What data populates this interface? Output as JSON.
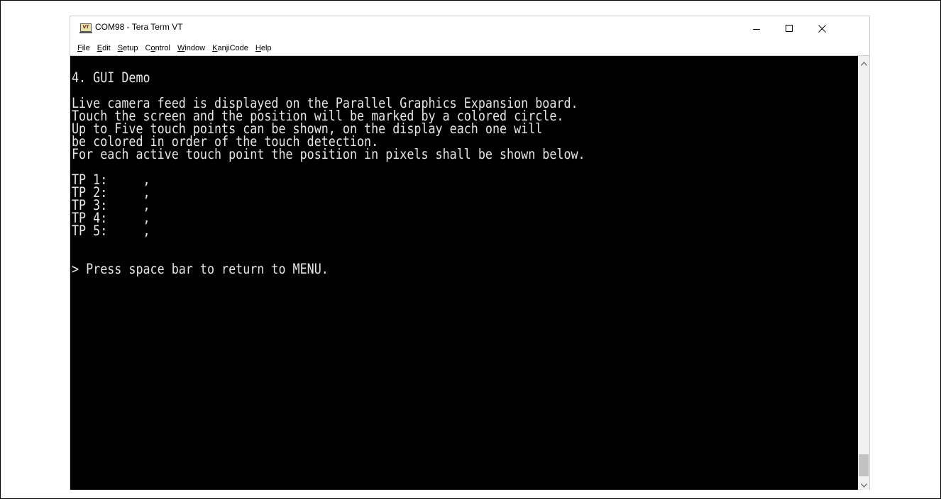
{
  "window": {
    "title": "COM98 - Tera Term VT",
    "icon_label": "VT",
    "icon": "teraterm-app-icon"
  },
  "caption_buttons": {
    "minimize_icon": "minimize-icon",
    "maximize_icon": "maximize-icon",
    "close_icon": "close-icon"
  },
  "menu": {
    "items": [
      {
        "accel": "F",
        "rest": "ile"
      },
      {
        "accel": "E",
        "rest": "dit"
      },
      {
        "accel": "S",
        "rest": "etup"
      },
      {
        "pre": "C",
        "accel": "o",
        "rest": "ntrol"
      },
      {
        "accel": "W",
        "rest": "indow"
      },
      {
        "accel": "K",
        "rest": "anjiCode"
      },
      {
        "accel": "H",
        "rest": "elp"
      }
    ]
  },
  "terminal": {
    "lines": [
      "4. GUI Demo",
      "",
      "Live camera feed is displayed on the Parallel Graphics Expansion board.",
      "Touch the screen and the position will be marked by a colored circle.",
      "Up to Five touch points can be shown, on the display each one will",
      "be colored in order of the touch detection.",
      "For each active touch point the position in pixels shall be shown below.",
      "",
      "TP 1:     ,",
      "TP 2:     ,",
      "TP 3:     ,",
      "TP 4:     ,",
      "TP 5:     ,",
      "",
      "",
      "> Press space bar to return to MENU."
    ],
    "background": "#000000",
    "foreground": "#e6e6e6"
  },
  "scrollbar": {
    "up_icon": "scroll-up-arrow-icon",
    "down_icon": "scroll-down-arrow-icon",
    "position": 1.0
  }
}
